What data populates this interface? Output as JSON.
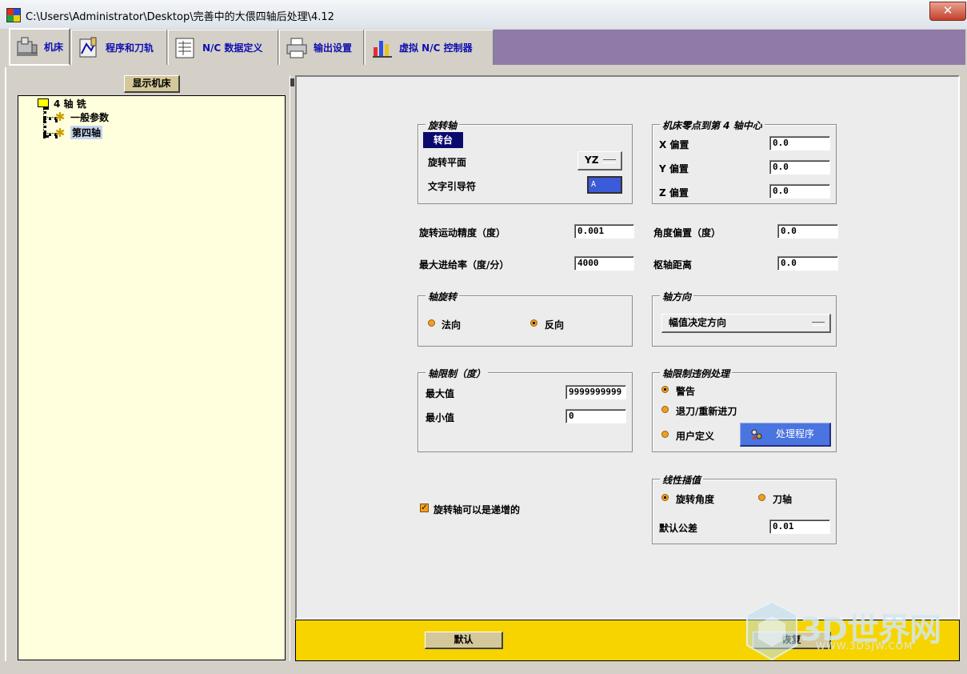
{
  "window": {
    "title": "C:\\Users\\Administrator\\Desktop\\完善中的大偎四轴后处理\\4.12",
    "close_glyph": "✕"
  },
  "tabs": [
    {
      "label": "机床",
      "icon": "machine-tool-icon",
      "active": true
    },
    {
      "label": "程序和刀轨",
      "icon": "program-toolpath-icon",
      "active": false
    },
    {
      "label": "N/C 数据定义",
      "icon": "nc-data-icon",
      "active": false
    },
    {
      "label": "输出设置",
      "icon": "printer-icon",
      "active": false
    },
    {
      "label": "虚拟 N/C 控制器",
      "icon": "virtual-controller-icon",
      "active": false
    }
  ],
  "left": {
    "show_machine_button": "显示机床",
    "tree": {
      "root": "4 轴 铣",
      "children": [
        {
          "label": "一般参数",
          "selected": false
        },
        {
          "label": "第四轴",
          "selected": true
        }
      ]
    }
  },
  "rotary_axis": {
    "title": "旋转轴",
    "type_badge": "转台",
    "plane_label": "旋转平面",
    "plane_value": "YZ",
    "leader_label": "文字引导符",
    "leader_value": "A"
  },
  "offset_group": {
    "title": "机床零点到第 4 轴中心",
    "x_label": "X 偏置",
    "x_value": "0.0",
    "y_label": "Y 偏置",
    "y_value": "0.0",
    "z_label": "Z 偏置",
    "z_value": "0.0"
  },
  "params": {
    "precision_label": "旋转运动精度（度）",
    "precision_value": "0.001",
    "max_feed_label": "最大进给率（度/分）",
    "max_feed_value": "4000",
    "angle_offset_label": "角度偏置（度）",
    "angle_offset_value": "0.0",
    "pivot_label": "枢轴距离",
    "pivot_value": "0.0"
  },
  "axis_rotation": {
    "title": "轴旋转",
    "normal_label": "法向",
    "reverse_label": "反向",
    "selected": "reverse"
  },
  "axis_direction": {
    "title": "轴方向",
    "value": "幅值决定方向"
  },
  "axis_limits": {
    "title": "轴限制（度）",
    "max_label": "最大值",
    "max_value": "9999999999",
    "min_label": "最小值",
    "min_value": "0"
  },
  "limit_violation": {
    "title": "轴限制违例处理",
    "options": [
      "警告",
      "退刀/重新进刀",
      "用户定义"
    ],
    "selected": 0,
    "handler_button": "处理程序"
  },
  "incremental": {
    "label": "旋转轴可以是递增的",
    "checked": true
  },
  "linearization": {
    "title": "线性插值",
    "rotary_angle_label": "旋转角度",
    "tool_axis_label": "刀轴",
    "selected": "rotary_angle",
    "tolerance_label": "默认公差",
    "tolerance_value": "0.01"
  },
  "bottom": {
    "default_button": "默认",
    "restore_button": "恢复"
  },
  "watermark": {
    "text": "3D世界网",
    "sub": "WWW.3DSJW.COM"
  },
  "colors": {
    "tab_fill": "#8f7aa8",
    "tree_bg": "#fffedd",
    "bottom_bar": "#f7d400",
    "badge": "#0a0a6e",
    "radio": "#f0a020"
  }
}
